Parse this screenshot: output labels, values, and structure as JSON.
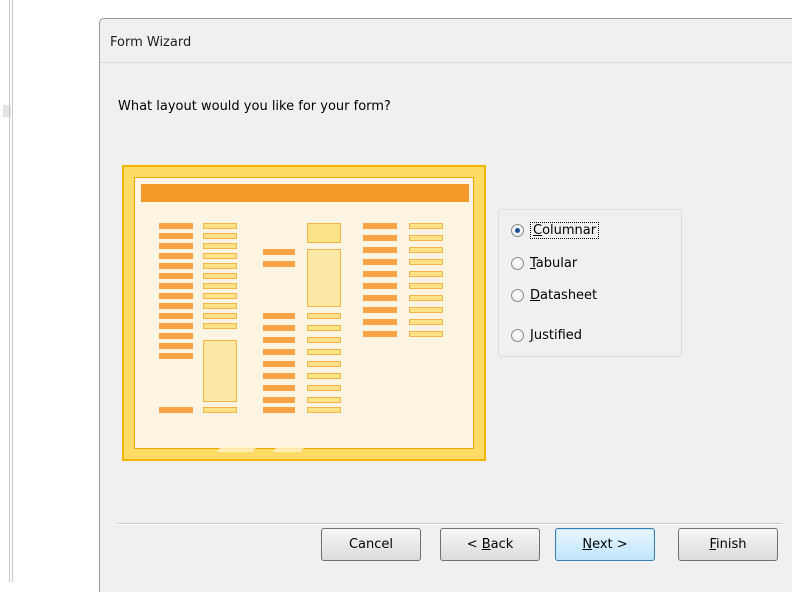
{
  "dialog": {
    "title": "Form Wizard",
    "question": "What layout would you like for your form?"
  },
  "layout_options": [
    {
      "label": "Columnar",
      "mnemonic": "C",
      "rest": "olumnar",
      "selected": true
    },
    {
      "label": "Tabular",
      "mnemonic": "T",
      "rest": "abular",
      "selected": false
    },
    {
      "label": "Datasheet",
      "mnemonic": "D",
      "rest": "atasheet",
      "selected": false
    },
    {
      "label": "Justified",
      "mnemonic": "J",
      "rest": "ustified",
      "selected": false
    }
  ],
  "buttons": {
    "cancel": "Cancel",
    "back_prefix": "< ",
    "back_mnemonic": "B",
    "back_rest": "ack",
    "next_mnemonic": "N",
    "next_rest": "ext >",
    "finish_mnemonic": "F",
    "finish_rest": "inish"
  },
  "colors": {
    "accent": "#f39a2a",
    "preview_border": "#f5b400",
    "default_button": "#3c7fb1"
  }
}
